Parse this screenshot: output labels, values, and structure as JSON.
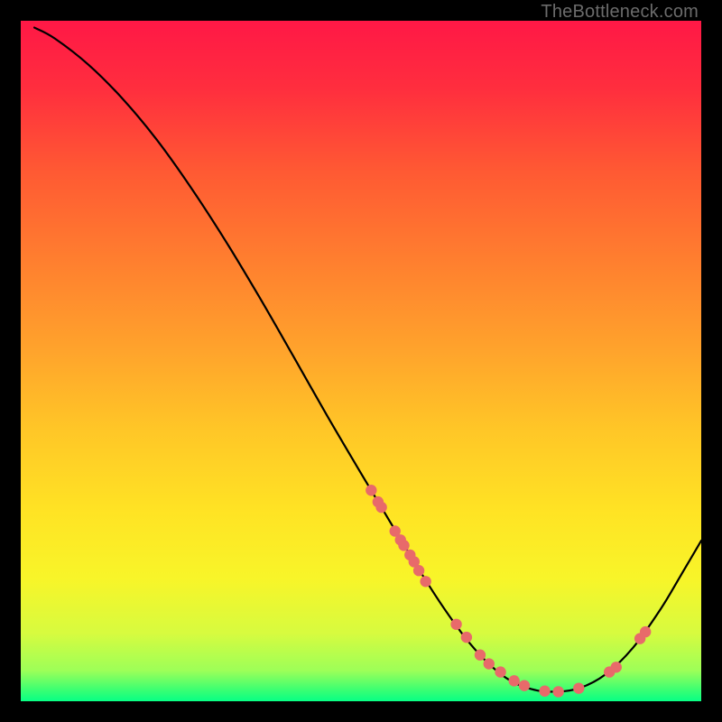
{
  "watermark": "TheBottleneck.com",
  "chart_data": {
    "type": "line",
    "title": "",
    "xlabel": "",
    "ylabel": "",
    "xlim": [
      0,
      100
    ],
    "ylim": [
      0,
      100
    ],
    "grid": false,
    "legend": false,
    "series": [
      {
        "name": "bottleneck-curve",
        "x": [
          2,
          5,
          10,
          15,
          20,
          25,
          30,
          35,
          40,
          45,
          50,
          53,
          56,
          60,
          63,
          66,
          69,
          72,
          75,
          78,
          82,
          86,
          90,
          94,
          97,
          100
        ],
        "y": [
          99,
          97.4,
          93.5,
          88.5,
          82.5,
          75.5,
          67.8,
          59.5,
          50.8,
          42,
          33.5,
          28.5,
          23.5,
          17,
          12.5,
          8.5,
          5.3,
          3.0,
          1.8,
          1.4,
          1.9,
          4.0,
          7.9,
          13.5,
          18.5,
          23.6
        ]
      }
    ],
    "scatter_points": {
      "name": "sample-points",
      "x": [
        51.5,
        52.5,
        53.0,
        55.0,
        55.8,
        56.3,
        57.2,
        57.8,
        58.5,
        59.5,
        64.0,
        65.5,
        67.5,
        68.8,
        70.5,
        72.5,
        74.0,
        77.0,
        79.0,
        82.0,
        86.5,
        87.5,
        91.0,
        91.8
      ],
      "y": [
        31.0,
        29.3,
        28.5,
        25.0,
        23.7,
        22.9,
        21.5,
        20.5,
        19.2,
        17.6,
        11.3,
        9.4,
        6.8,
        5.5,
        4.3,
        3.0,
        2.3,
        1.5,
        1.4,
        1.9,
        4.3,
        5.0,
        9.2,
        10.2
      ]
    },
    "gradient_stops": [
      {
        "offset": 0,
        "color": "#ff1846"
      },
      {
        "offset": 0.1,
        "color": "#ff2e3e"
      },
      {
        "offset": 0.22,
        "color": "#ff5933"
      },
      {
        "offset": 0.35,
        "color": "#ff7e2f"
      },
      {
        "offset": 0.48,
        "color": "#ffa22c"
      },
      {
        "offset": 0.6,
        "color": "#ffc627"
      },
      {
        "offset": 0.72,
        "color": "#ffe324"
      },
      {
        "offset": 0.82,
        "color": "#f8f529"
      },
      {
        "offset": 0.9,
        "color": "#d7fb3f"
      },
      {
        "offset": 0.955,
        "color": "#9dff58"
      },
      {
        "offset": 0.985,
        "color": "#35ff74"
      },
      {
        "offset": 1.0,
        "color": "#08ff85"
      }
    ],
    "colors": {
      "curve": "#000000",
      "points": "#e86a6a",
      "background": "#000000"
    }
  }
}
